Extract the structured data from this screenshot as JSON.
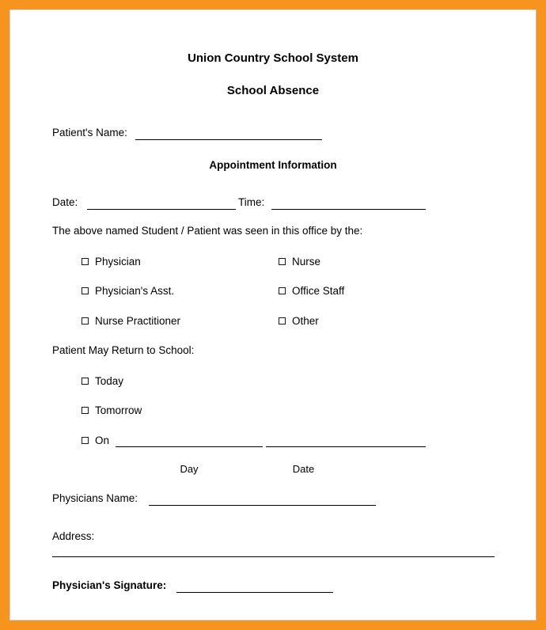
{
  "page": {
    "border_color": "#f7941e",
    "paper_color": "#ffffff",
    "ink_color": "#000000"
  },
  "header": {
    "organization": "Union Country School System",
    "form_title": "School Absence"
  },
  "patient": {
    "name_label": "Patient's Name:",
    "name_value": ""
  },
  "appointment": {
    "section_title": "Appointment Information",
    "date_label": "Date:",
    "date_value": "",
    "time_label": "Time:",
    "time_value": "",
    "seen_by_statement": "The above named Student / Patient was seen in this office by the:",
    "seen_by_options": [
      {
        "label": "Physician",
        "checked": false,
        "column": "left"
      },
      {
        "label": "Nurse",
        "checked": false,
        "column": "right"
      },
      {
        "label": "Physician's Asst.",
        "checked": false,
        "column": "left"
      },
      {
        "label": "Office Staff",
        "checked": false,
        "column": "right"
      },
      {
        "label": "Nurse Practitioner",
        "checked": false,
        "column": "left"
      },
      {
        "label": "Other",
        "checked": false,
        "column": "right"
      }
    ]
  },
  "return_to_school": {
    "heading": "Patient May Return to School:",
    "options": [
      {
        "label": "Today",
        "checked": false
      },
      {
        "label": "Tomorrow",
        "checked": false
      },
      {
        "label": "On",
        "checked": false
      }
    ],
    "on_day_value": "",
    "on_date_value": "",
    "day_sublabel": "Day",
    "date_sublabel": "Date"
  },
  "physician": {
    "name_label": "Physicians Name:",
    "name_value": "",
    "address_label": "Address:",
    "address_value": "",
    "signature_label": "Physician's Signature:",
    "signature_value": ""
  }
}
